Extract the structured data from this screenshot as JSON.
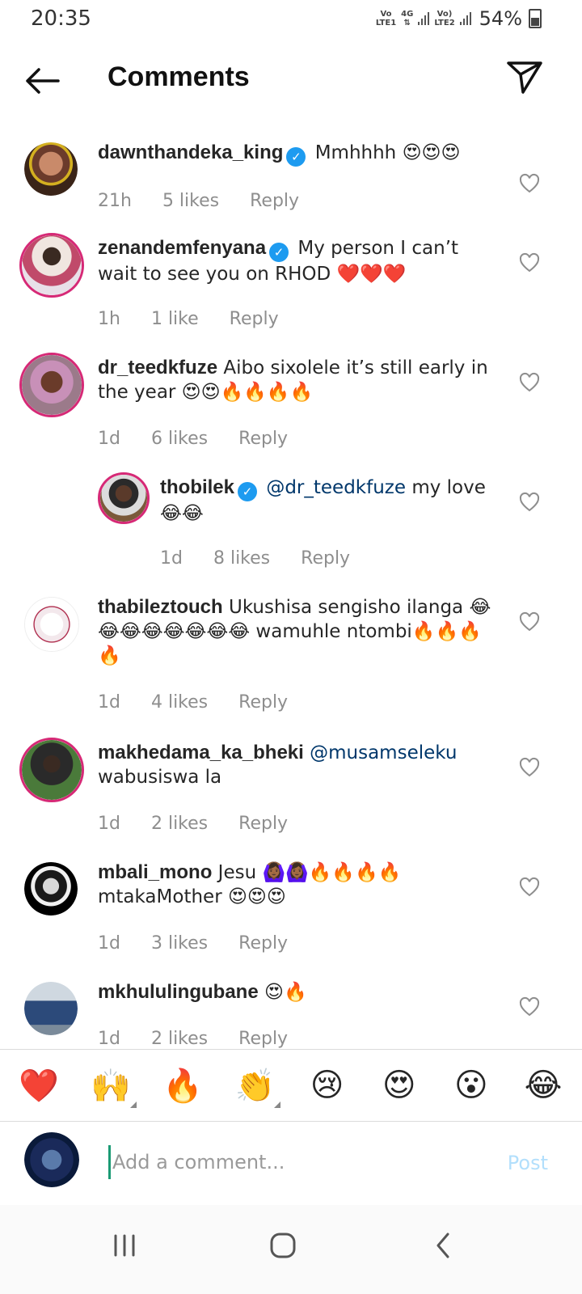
{
  "status": {
    "time": "20:35",
    "sim1": "LTE1",
    "sim1_tag": "Vo",
    "sim1_net": "4G",
    "sim2": "LTE2",
    "sim2_tag": "Vo)",
    "battery": "54%"
  },
  "header": {
    "title": "Comments",
    "back_icon": "arrow-left-icon",
    "share_icon": "paper-plane-icon"
  },
  "comments": [
    {
      "user": "dawnthandeka_king",
      "verified": true,
      "text": "Mmhhhh 😍😍😍",
      "time": "21h",
      "likes": "5 likes",
      "reply": "Reply"
    },
    {
      "user": "zenandemfenyana",
      "verified": true,
      "text": "My person I can’t wait to see you on RHOD ❤️❤️❤️",
      "time": "1h",
      "likes": "1 like",
      "reply": "Reply"
    },
    {
      "user": "dr_teedkfuze",
      "verified": false,
      "text": "Aibo sixolele it’s still early in the year 😍😍🔥🔥🔥🔥",
      "time": "1d",
      "likes": "6 likes",
      "reply": "Reply"
    },
    {
      "user": "thobilek",
      "verified": true,
      "mention": "@dr_teedkfuze",
      "text": "my love 😂😂",
      "time": "1d",
      "likes": "8 likes",
      "reply": "Reply"
    },
    {
      "user": "thabileztouch",
      "verified": false,
      "text": "Ukushisa sengisho ilanga 😂😂😂😂😂😂😂😂 wamuhle ntombi🔥🔥🔥🔥",
      "time": "1d",
      "likes": "4 likes",
      "reply": "Reply"
    },
    {
      "user": "makhedama_ka_bheki",
      "verified": false,
      "mention": "@musamseleku",
      "text": "wabusiswa la",
      "time": "1d",
      "likes": "2 likes",
      "reply": "Reply"
    },
    {
      "user": "mbali_mono",
      "verified": false,
      "text": "Jesu 🙆🏾‍♀️🙆🏾‍♀️🔥🔥🔥🔥 mtakaMother 😍😍😍",
      "time": "1d",
      "likes": "3 likes",
      "reply": "Reply"
    },
    {
      "user": "mkhululingubane",
      "verified": false,
      "text": "😍🔥",
      "time": "1d",
      "likes": "2 likes",
      "reply": "Reply"
    }
  ],
  "reactions": [
    "❤️",
    "🙌",
    "🔥",
    "👏",
    "😢",
    "😍",
    "😮",
    "😂"
  ],
  "composer": {
    "placeholder": "Add a comment...",
    "post": "Post"
  },
  "colors": {
    "accent": "#1d9bf0",
    "post_disabled": "#b2dffc",
    "ring": "#d62976",
    "meta": "#8e8e8e"
  }
}
